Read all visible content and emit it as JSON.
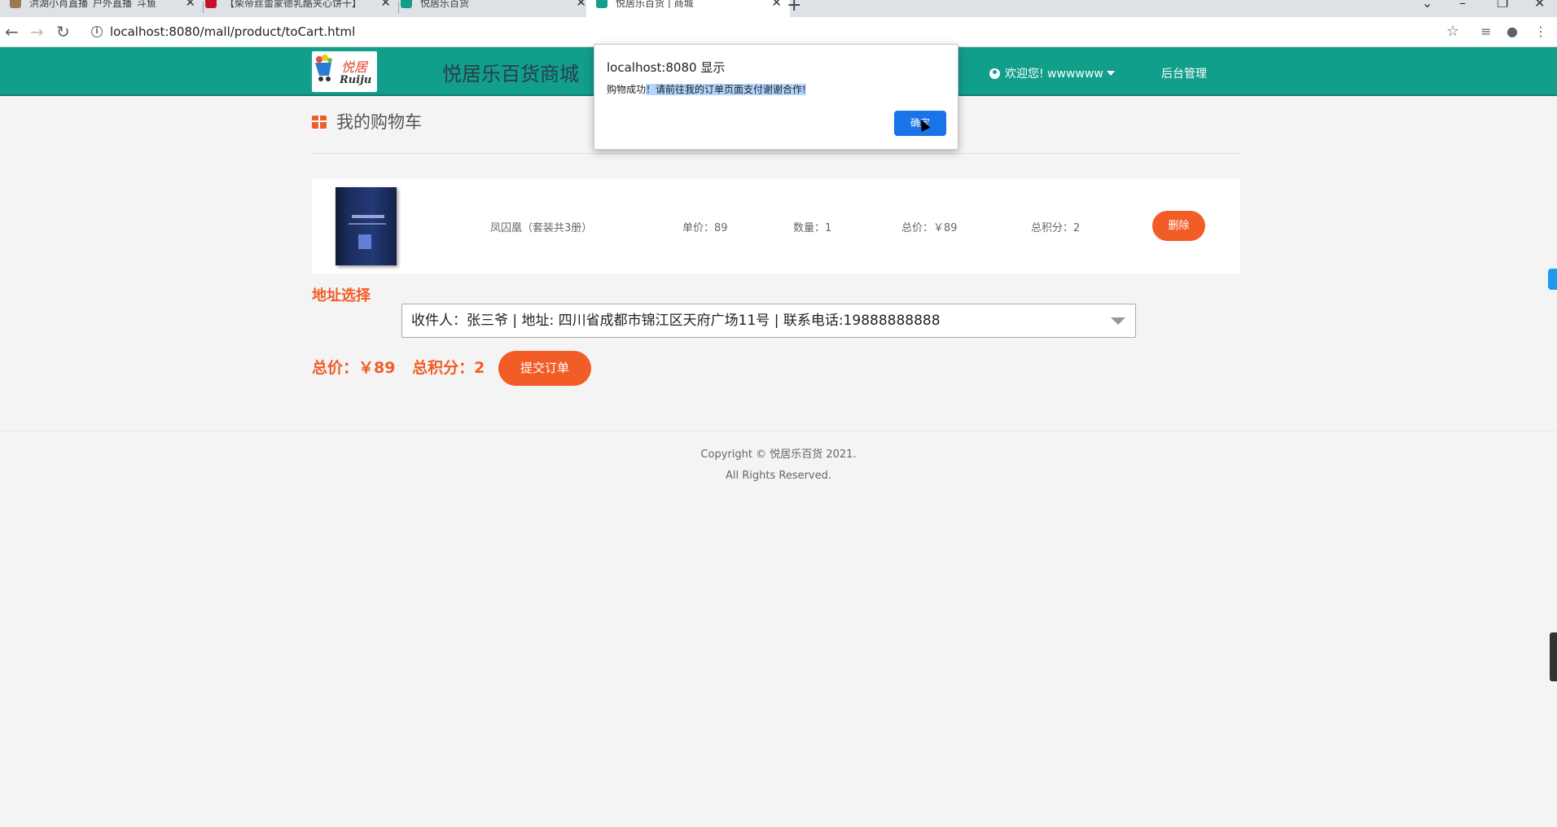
{
  "browser": {
    "tabs": [
      {
        "label": "洪湖小肖直播_户外直播_斗鱼",
        "favicon_color": "#9a7a55",
        "active": false
      },
      {
        "label": "【柴帝丝蕾蒙德乳酪夹心饼干】",
        "favicon_color": "#c8102e",
        "favicon_text": "JD",
        "active": false
      },
      {
        "label": "悦居乐百货",
        "favicon_color": "#119e8b",
        "active": false
      },
      {
        "label": "悦居乐百货 | 商城",
        "favicon_color": "#119e8b",
        "active": true
      }
    ],
    "new_tab": "+",
    "url": "localhost:8080/mall/product/toCart.html"
  },
  "header": {
    "logo_text": "悦居",
    "logo_sub": "Ruiju",
    "title": "悦居乐百货商城",
    "welcome": "欢迎您! wwwwww",
    "admin_link": "后台管理"
  },
  "cart": {
    "title": "我的购物车",
    "item": {
      "name": "凤囚凰（套装共3册）",
      "unit_price": "单价：89",
      "quantity": "数量：1",
      "total": "总价：￥89",
      "points": "总积分：2",
      "delete_label": "删除"
    }
  },
  "address": {
    "label": "地址选择",
    "selected": "收件人：张三爷 | 地址: 四川省成都市锦江区天府广场11号 | 联系电话:19888888888"
  },
  "summary": {
    "total": "总价：￥89",
    "points": "总积分：2",
    "submit_label": "提交订单"
  },
  "footer": {
    "copyright": "Copyright © 悦居乐百货 2021.",
    "rights": "All Rights Reserved."
  },
  "dialog": {
    "title": "localhost:8080 显示",
    "message_plain": "购物成功",
    "message_highlighted": "！请前往我的订单页面支付谢谢合作!",
    "ok_label": "确定"
  },
  "colors": {
    "header_bg": "#119e8b",
    "accent": "#f25c27",
    "dialog_button": "#1a73e8"
  }
}
